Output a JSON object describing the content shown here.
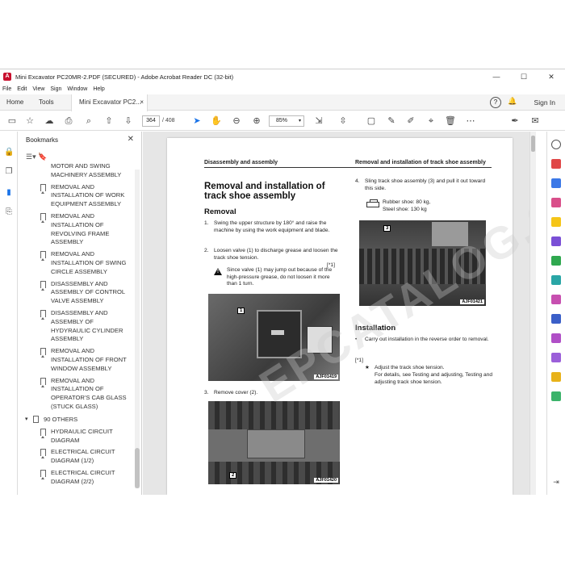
{
  "window": {
    "title": "Mini Excavator PC20MR-2.PDF (SECURED) - Adobe Acrobat Reader DC (32-bit)",
    "min": "—",
    "max": "☐",
    "close": "✕"
  },
  "menu": [
    "File",
    "Edit",
    "View",
    "Sign",
    "Window",
    "Help"
  ],
  "tabs": {
    "home": "Home",
    "tools": "Tools",
    "doc": "Mini Excavator PC2...",
    "doc_close": "×",
    "help": "?",
    "bell": "🔔",
    "sign_in": "Sign In"
  },
  "toolbar": {
    "page_current": "364",
    "page_total": "/ 408",
    "zoom": "85%",
    "zoom_caret": "▾"
  },
  "bookmarks": {
    "header": "Bookmarks",
    "close": "✕",
    "tools": "☰▾   🔖",
    "items": [
      "MOTOR AND SWING MACHINERY ASSEMBLY",
      "REMOVAL AND INSTALLATION OF WORK EQUIPMENT ASSEMBLY",
      "REMOVAL AND INSTALLATION OF REVOLVING FRAME ASSEMBLY",
      "REMOVAL AND INSTALLATION OF SWING CIRCLE ASSEMBLY",
      "DISASSEMBLY AND ASSEMBLY OF CONTROL VALVE ASSEMBLY",
      "DISASSEMBLY AND ASSEMBLY OF HYDYRAULIC CYLINDER ASSEMBLY",
      "REMOVAL AND INSTALLATION OF FRONT WINDOW ASSEMBLY",
      "REMOVAL AND INSTALLATION OF OPERATOR'S CAB GLASS (STUCK GLASS)"
    ],
    "section": {
      "chevron": "▾",
      "label": "90 OTHERS"
    },
    "sub_items": [
      "HYDRAULIC CIRCUIT DIAGRAM",
      "ELECTRICAL CIRCUIT DIAGRAM (1/2)",
      "ELECTRICAL CIRCUIT DIAGRAM (2/2)"
    ]
  },
  "page": {
    "header_left": "Disassembly and assembly",
    "header_right": "Removal and installation of track shoe assembly",
    "title": "Removal and installation of track shoe assembly",
    "removal_heading": "Removal",
    "step1_num": "1.",
    "step1": "Swing the upper structure by 180° and raise the machine by using the work equipment and blade.",
    "step2_num": "2.",
    "step2": "Loosen valve (1) to discharge grease and loosen the track shoe tension.",
    "step2_ref": "[*1]",
    "step2_warn": "Since valve (1) may jump out because of the high-pressure grease, do not loosen it more than 1 turn.",
    "photo1_tag": "1",
    "photo1_cap": "AJF01419",
    "step3_num": "3.",
    "step3": "Remove cover (2).",
    "photo2_tag": "2",
    "photo2_cap": "AJF01420",
    "step4_num": "4.",
    "step4": "Sling track shoe assembly (3) and pull it out toward this side.",
    "weight1": "Rubber shoe: 80 kg,",
    "weight2": "Steel shoe: 130 kg",
    "photo3_tag": "3",
    "photo3_cap": "AJF01421",
    "install_heading": "Installation",
    "install_text": "Carry out installation in the reverse order to removal.",
    "ref_note": "[*1]",
    "star": "★",
    "adjust1": "Adjust the track shoe tension.",
    "adjust2": "For details, see Testing and adjusting, Testing and adjusting track shoe tension."
  },
  "watermark": "EPCATALOG.COM",
  "colors": {
    "brand": "#c8102e",
    "selection_icon": "#1a73e8"
  }
}
